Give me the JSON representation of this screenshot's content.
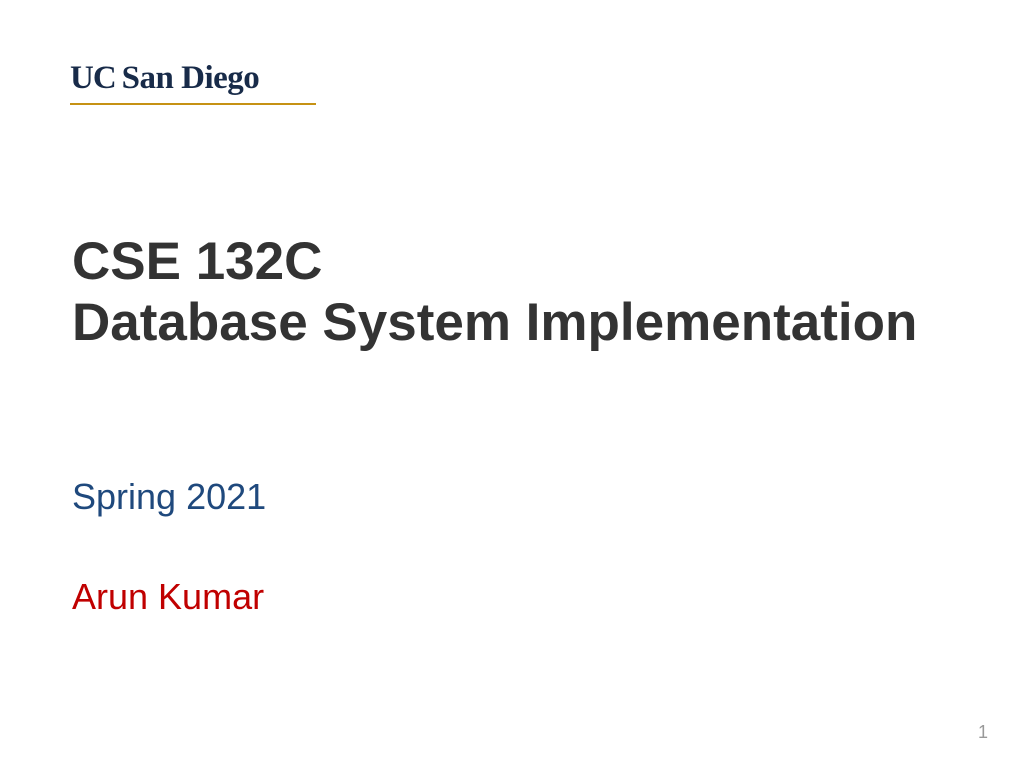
{
  "logo": {
    "text_uc": "UC",
    "text_sandiego": "San Diego"
  },
  "title": {
    "course_code": "CSE 132C",
    "course_name": "Database System Implementation"
  },
  "term": "Spring 2021",
  "author": "Arun Kumar",
  "page_number": "1"
}
